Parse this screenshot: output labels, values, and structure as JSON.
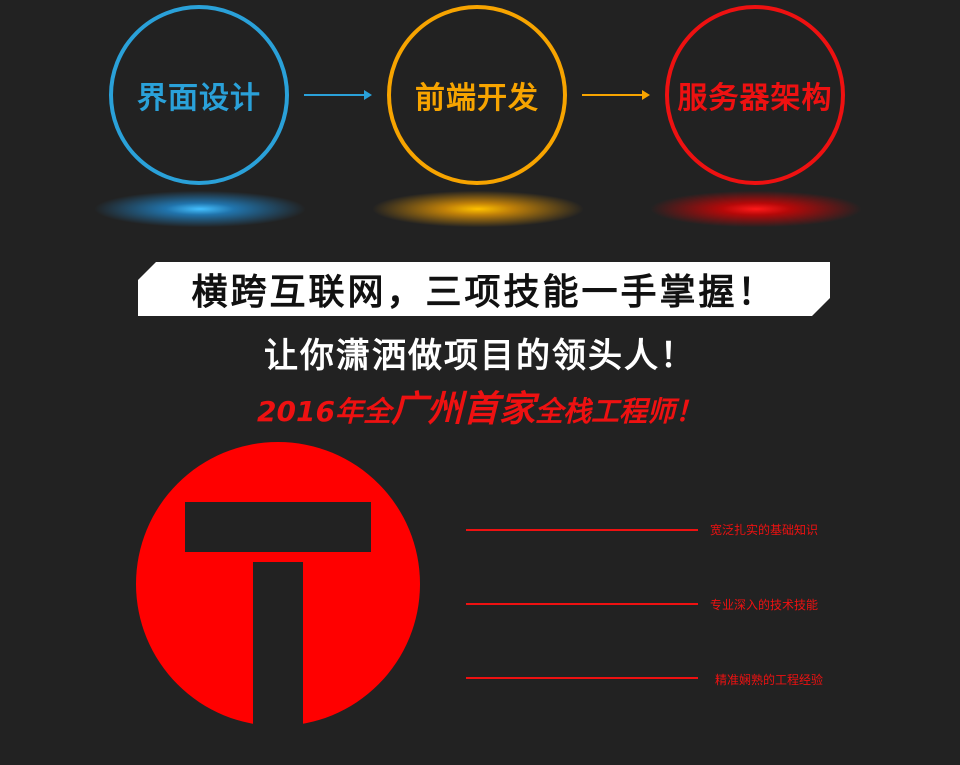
{
  "stages": [
    {
      "label": "界面设计",
      "color": "#2aa1d9"
    },
    {
      "label": "前端开发",
      "color": "#f7a400"
    },
    {
      "label": "服务器架构",
      "color": "#ee1111"
    }
  ],
  "banner": {
    "headline": "横跨互联网，三项技能一手掌握！",
    "subtitle": "让你潇洒做项目的领头人！",
    "tagline": {
      "prefix": "2016年全",
      "emphasis": "广州首家",
      "suffix": "全栈工程师！"
    }
  },
  "skills": [
    "宽泛扎实的基础知识",
    "专业深入的技术技能",
    "精准娴熟的工程经验"
  ],
  "colors": {
    "background": "#222222",
    "accent_red": "#ee1111",
    "logo_red": "#ff0000"
  }
}
